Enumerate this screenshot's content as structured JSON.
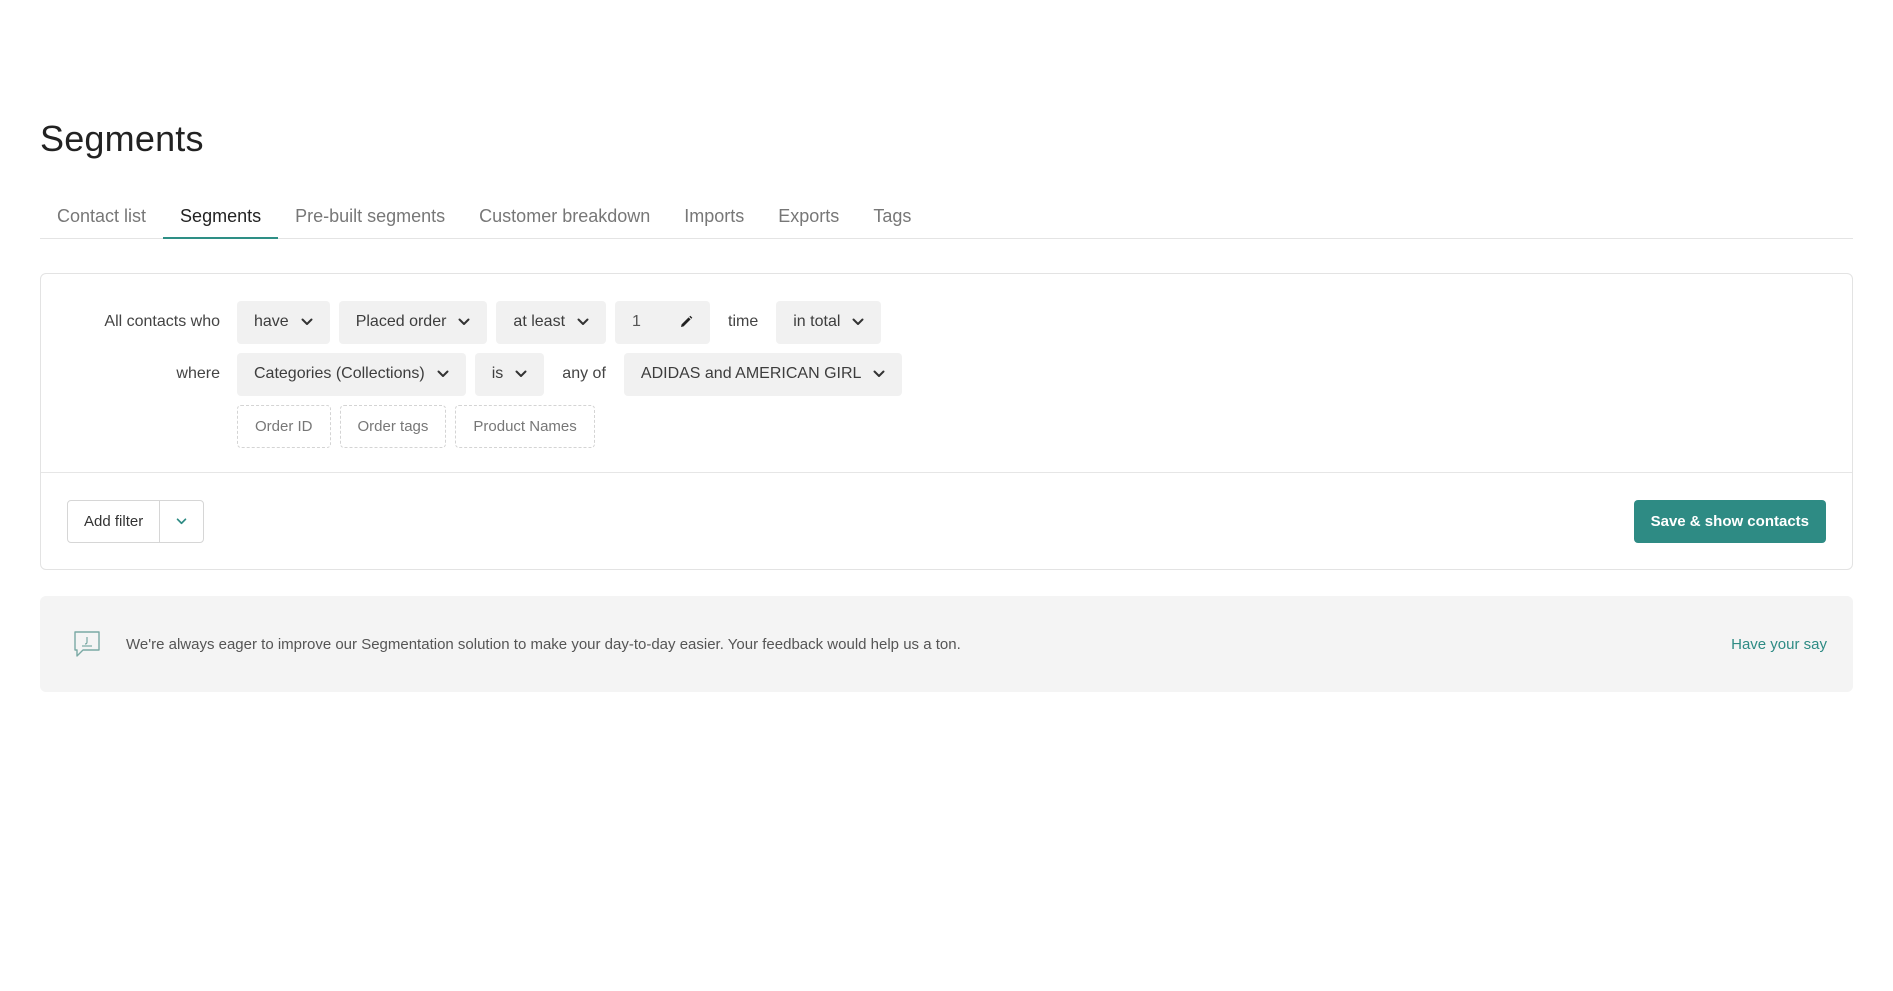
{
  "page": {
    "title": "Segments"
  },
  "tabs": [
    {
      "label": "Contact list",
      "active": false
    },
    {
      "label": "Segments",
      "active": true
    },
    {
      "label": "Pre-built segments",
      "active": false
    },
    {
      "label": "Customer breakdown",
      "active": false
    },
    {
      "label": "Imports",
      "active": false
    },
    {
      "label": "Exports",
      "active": false
    },
    {
      "label": "Tags",
      "active": false
    }
  ],
  "segment": {
    "row1": {
      "label": "All contacts who",
      "verb": "have",
      "event": "Placed order",
      "comparator": "at least",
      "count": "1",
      "unit": "time",
      "period": "in total"
    },
    "row2": {
      "label": "where",
      "property": "Categories (Collections)",
      "operator": "is",
      "connector": "any of",
      "value": "ADIDAS and AMERICAN GIRL"
    },
    "suggestions": [
      "Order ID",
      "Order tags",
      "Product Names"
    ]
  },
  "footer": {
    "add_filter": "Add filter",
    "save": "Save & show contacts"
  },
  "feedback": {
    "text": "We're always eager to improve our Segmentation solution to make your day-to-day easier. Your feedback would help us a ton.",
    "link": "Have your say"
  },
  "colors": {
    "accent": "#2e8b84",
    "pill_bg": "#f1f1f1",
    "feedback_bg": "#f4f4f4"
  },
  "icons": [
    "chevron-down-icon",
    "pencil-icon",
    "feedback-icon"
  ]
}
